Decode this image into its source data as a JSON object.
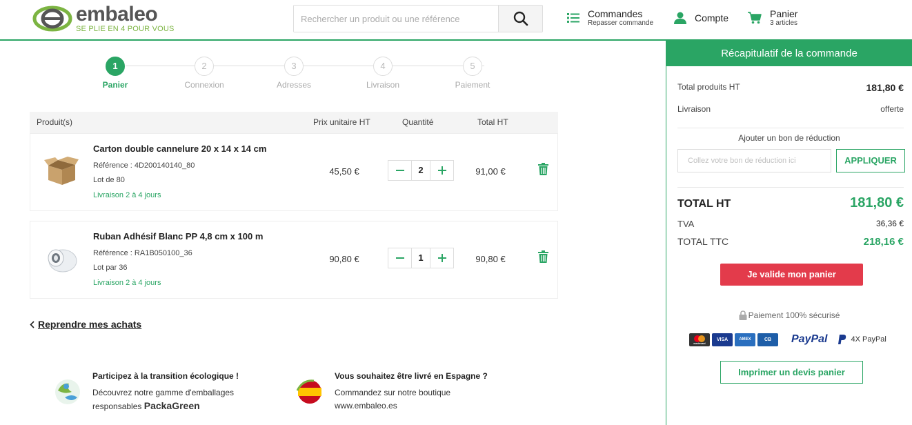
{
  "brand": {
    "name": "embaleo",
    "tagline": "SE PLIE EN 4 POUR VOUS"
  },
  "search": {
    "placeholder": "Rechercher un produit ou une référence"
  },
  "nav": {
    "orders": {
      "title": "Commandes",
      "subtitle": "Repasser commande"
    },
    "account": {
      "title": "Compte"
    },
    "cart": {
      "title": "Panier",
      "subtitle": "3 articles"
    }
  },
  "steps": [
    {
      "num": "1",
      "label": "Panier",
      "active": true
    },
    {
      "num": "2",
      "label": "Connexion",
      "active": false
    },
    {
      "num": "3",
      "label": "Adresses",
      "active": false
    },
    {
      "num": "4",
      "label": "Livraison",
      "active": false
    },
    {
      "num": "5",
      "label": "Paiement",
      "active": false
    }
  ],
  "table": {
    "headers": {
      "product": "Produit(s)",
      "unit": "Prix unitaire HT",
      "qty": "Quantité",
      "total": "Total HT"
    },
    "rows": [
      {
        "name": "Carton double cannelure 20 x 14 x 14 cm",
        "ref": "Référence : 4D200140140_80",
        "lot": "Lot de 80",
        "delivery": "Livraison 2 à 4 jours",
        "unit_price": "45,50 €",
        "qty": "2",
        "total": "91,00 €"
      },
      {
        "name": "Ruban Adhésif Blanc PP 4,8 cm x 100 m",
        "ref": "Référence : RA1B050100_36",
        "lot": "Lot par 36",
        "delivery": "Livraison 2 à 4 jours",
        "unit_price": "90,80 €",
        "qty": "1",
        "total": "90,80 €"
      }
    ]
  },
  "back_link": "Reprendre mes achats",
  "promos": {
    "eco": {
      "title": "Participez à la transition écologique !",
      "line1": "Découvrez notre gamme d'emballages",
      "line2": "responsables",
      "brand_a": "Packa",
      "brand_b": "Green"
    },
    "spain": {
      "title": "Vous souhaitez être livré en Espagne ?",
      "line1": "Commandez sur notre boutique",
      "line2": "www.embaleo.es"
    }
  },
  "summary": {
    "title": "Récapitulatif de la commande",
    "products_label": "Total produits HT",
    "products_value": "181,80 €",
    "shipping_label": "Livraison",
    "shipping_value": "offerte",
    "promo_title": "Ajouter un bon de réduction",
    "promo_placeholder": "Collez votre bon de réduction ici",
    "promo_button": "APPLIQUER",
    "total_ht_label": "TOTAL HT",
    "total_ht_value": "181,80 €",
    "tva_label": "TVA",
    "tva_value": "36,36 €",
    "total_ttc_label": "TOTAL TTC",
    "total_ttc_value": "218,16 €",
    "validate_button": "Je valide mon panier",
    "secure_text": "Paiement 100% sécurisé",
    "paypal": "PayPal",
    "paypal_4x": "4X PayPal",
    "print_button": "Imprimer un devis panier"
  },
  "cards": {
    "mastercard": "mastercard",
    "visa": "VISA",
    "amex": "AMEX",
    "cb": "CB"
  },
  "colors": {
    "accent": "#2aa564",
    "danger": "#e33b4b"
  }
}
